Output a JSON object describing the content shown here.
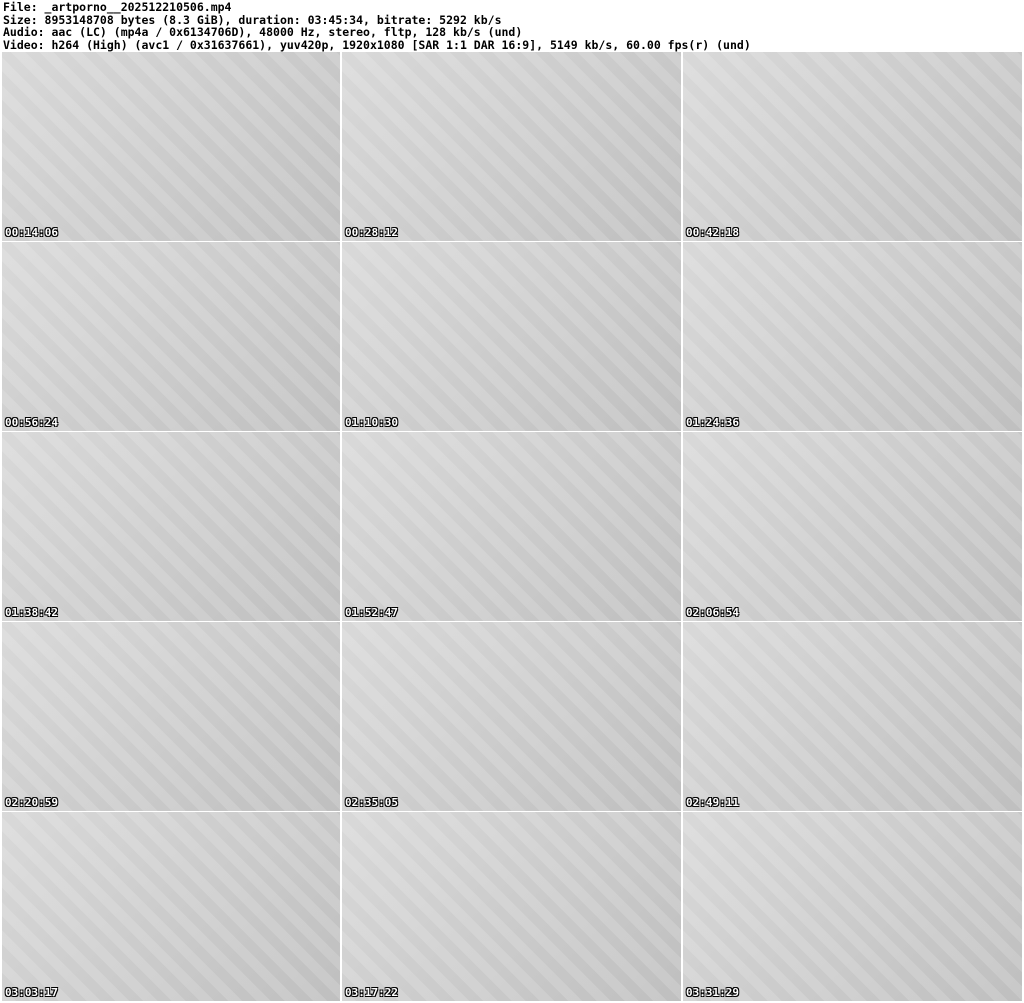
{
  "header": {
    "file": "File: _artporno__202512210506.mp4",
    "size": "Size: 8953148708 bytes (8.3 GiB), duration: 03:45:34, bitrate: 5292 kb/s",
    "audio": "Audio: aac (LC) (mp4a / 0x6134706D), 48000 Hz, stereo, fltp, 128 kb/s (und)",
    "video": "Video: h264 (High) (avc1 / 0x31637661), yuv420p, 1920x1080 [SAR 1:1 DAR 16:9], 5149 kb/s, 60.00 fps(r) (und)"
  },
  "thumbnails": [
    {
      "timestamp": "00:14:06"
    },
    {
      "timestamp": "00:28:12"
    },
    {
      "timestamp": "00:42:18"
    },
    {
      "timestamp": "00:56:24"
    },
    {
      "timestamp": "01:10:30"
    },
    {
      "timestamp": "01:24:36"
    },
    {
      "timestamp": "01:38:42"
    },
    {
      "timestamp": "01:52:47"
    },
    {
      "timestamp": "02:06:54"
    },
    {
      "timestamp": "02:20:59"
    },
    {
      "timestamp": "02:35:05"
    },
    {
      "timestamp": "02:49:11"
    },
    {
      "timestamp": "03:03:17"
    },
    {
      "timestamp": "03:17:22"
    },
    {
      "timestamp": "03:31:29"
    }
  ]
}
